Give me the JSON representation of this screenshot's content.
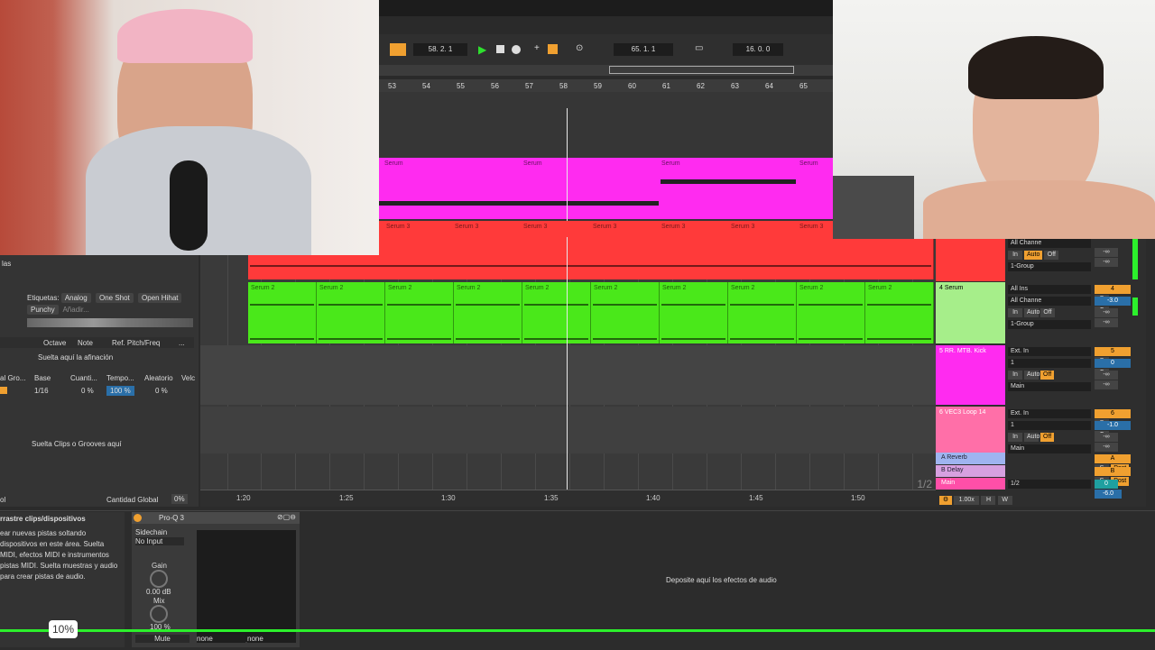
{
  "transport": {
    "position": "58. 2. 1",
    "loop_start": "65. 1. 1",
    "loop_length": "16. 0. 0"
  },
  "ruler_bars": [
    "53",
    "54",
    "55",
    "56",
    "57",
    "58",
    "59",
    "60",
    "61",
    "62",
    "63",
    "64",
    "65"
  ],
  "top_clips": {
    "magenta_label": "Serum",
    "red_label": "Serum 3"
  },
  "arrangement": {
    "red_label": "Serum 3",
    "green_label": "Serum 2",
    "time_labels": [
      "1:20",
      "1:25",
      "1:30",
      "1:35",
      "1:40",
      "1:45",
      "1:50"
    ],
    "page_indicator": "1/2"
  },
  "browser": {
    "label_tags": "Etiquetas:",
    "tags": [
      "Analog",
      "One Shot",
      "Open Hihat",
      "Punchy",
      "Añadir..."
    ],
    "columns": [
      "Octave",
      "Note",
      "Ref. Pitch/Freq",
      "..."
    ],
    "drop_tuning": "Suelta aquí la afinación",
    "groove_headers": [
      "al Gro...",
      "Base",
      "Cuanti...",
      "Tempo...",
      "Aleatorio",
      "Velc"
    ],
    "groove_values": [
      "1/16",
      "0 %",
      "100 %",
      "0 %"
    ],
    "drop_grooves": "Suelta Clips o Grooves aquí",
    "global_amount_label": "Cantidad Global",
    "global_amount_value": "0%",
    "side_label": "las",
    "left_edge": "ol"
  },
  "mixer": {
    "tracks": [
      {
        "name": "4 Serum",
        "color": "#4ae81a",
        "in1": "All Ins",
        "in2": "All Channe",
        "out": "1-Group",
        "num": "4",
        "vol": "-3.0",
        "pan": "C",
        "s1": "-∞",
        "s2": "-∞",
        "auto": "Auto",
        "off": "Off",
        "in": "In"
      },
      {
        "name": "5 RR. MTB. Kick",
        "color": "#ff2bf0",
        "in1": "Ext. In",
        "in2": "1",
        "out": "Main",
        "num": "5",
        "vol": "0",
        "pan": "C",
        "s1": "-∞",
        "s2": "-∞",
        "auto": "Auto",
        "off": "Off",
        "in": "In"
      },
      {
        "name": "6 VEC3 Loop 14",
        "color": "#ff6fa8",
        "in1": "Ext. In",
        "in2": "1",
        "out": "Main",
        "num": "6",
        "vol": "-1.0",
        "pan": "C",
        "s1": "-∞",
        "s2": "-∞",
        "auto": "Auto",
        "off": "Off",
        "in": "In"
      }
    ],
    "top_partial": {
      "in1": "All Channe",
      "in": "In",
      "auto": "Auto",
      "off": "Off",
      "out": "1-Group",
      "s1": "-∞",
      "s2": "-∞"
    },
    "returns": [
      {
        "name": "A Reverb",
        "letter": "A",
        "post": "Post"
      },
      {
        "name": "B Delay",
        "letter": "B",
        "post": "Post"
      }
    ],
    "master": {
      "name": "Main",
      "out": "1/2",
      "vol": "0",
      "db": "-6.0"
    },
    "footer": {
      "zoom": "1.00x",
      "h": "H",
      "w": "W"
    },
    "solo": "S"
  },
  "bottom": {
    "hint_title": "rrastre clips/dispositivos",
    "hint_body": "ear nuevas pistas soltando dispositivos en este área. Suelta MIDI, efectos MIDI e instrumentos pistas MIDI. Suelta muestras y audio para crear pistas de audio.",
    "device_name": "Pro-Q 3",
    "sidechain_label": "Sidechain",
    "sidechain_value": "No Input",
    "gain_label": "Gain",
    "gain_value": "0.00 dB",
    "mix_label": "Mix",
    "mix_value": "100 %",
    "mute": "Mute",
    "none1": "none",
    "none2": "none",
    "drop_effects": "Deposite aquí los efectos de audio"
  },
  "overlay": {
    "progress_pct": "10%",
    "progress_value": 0.1
  }
}
